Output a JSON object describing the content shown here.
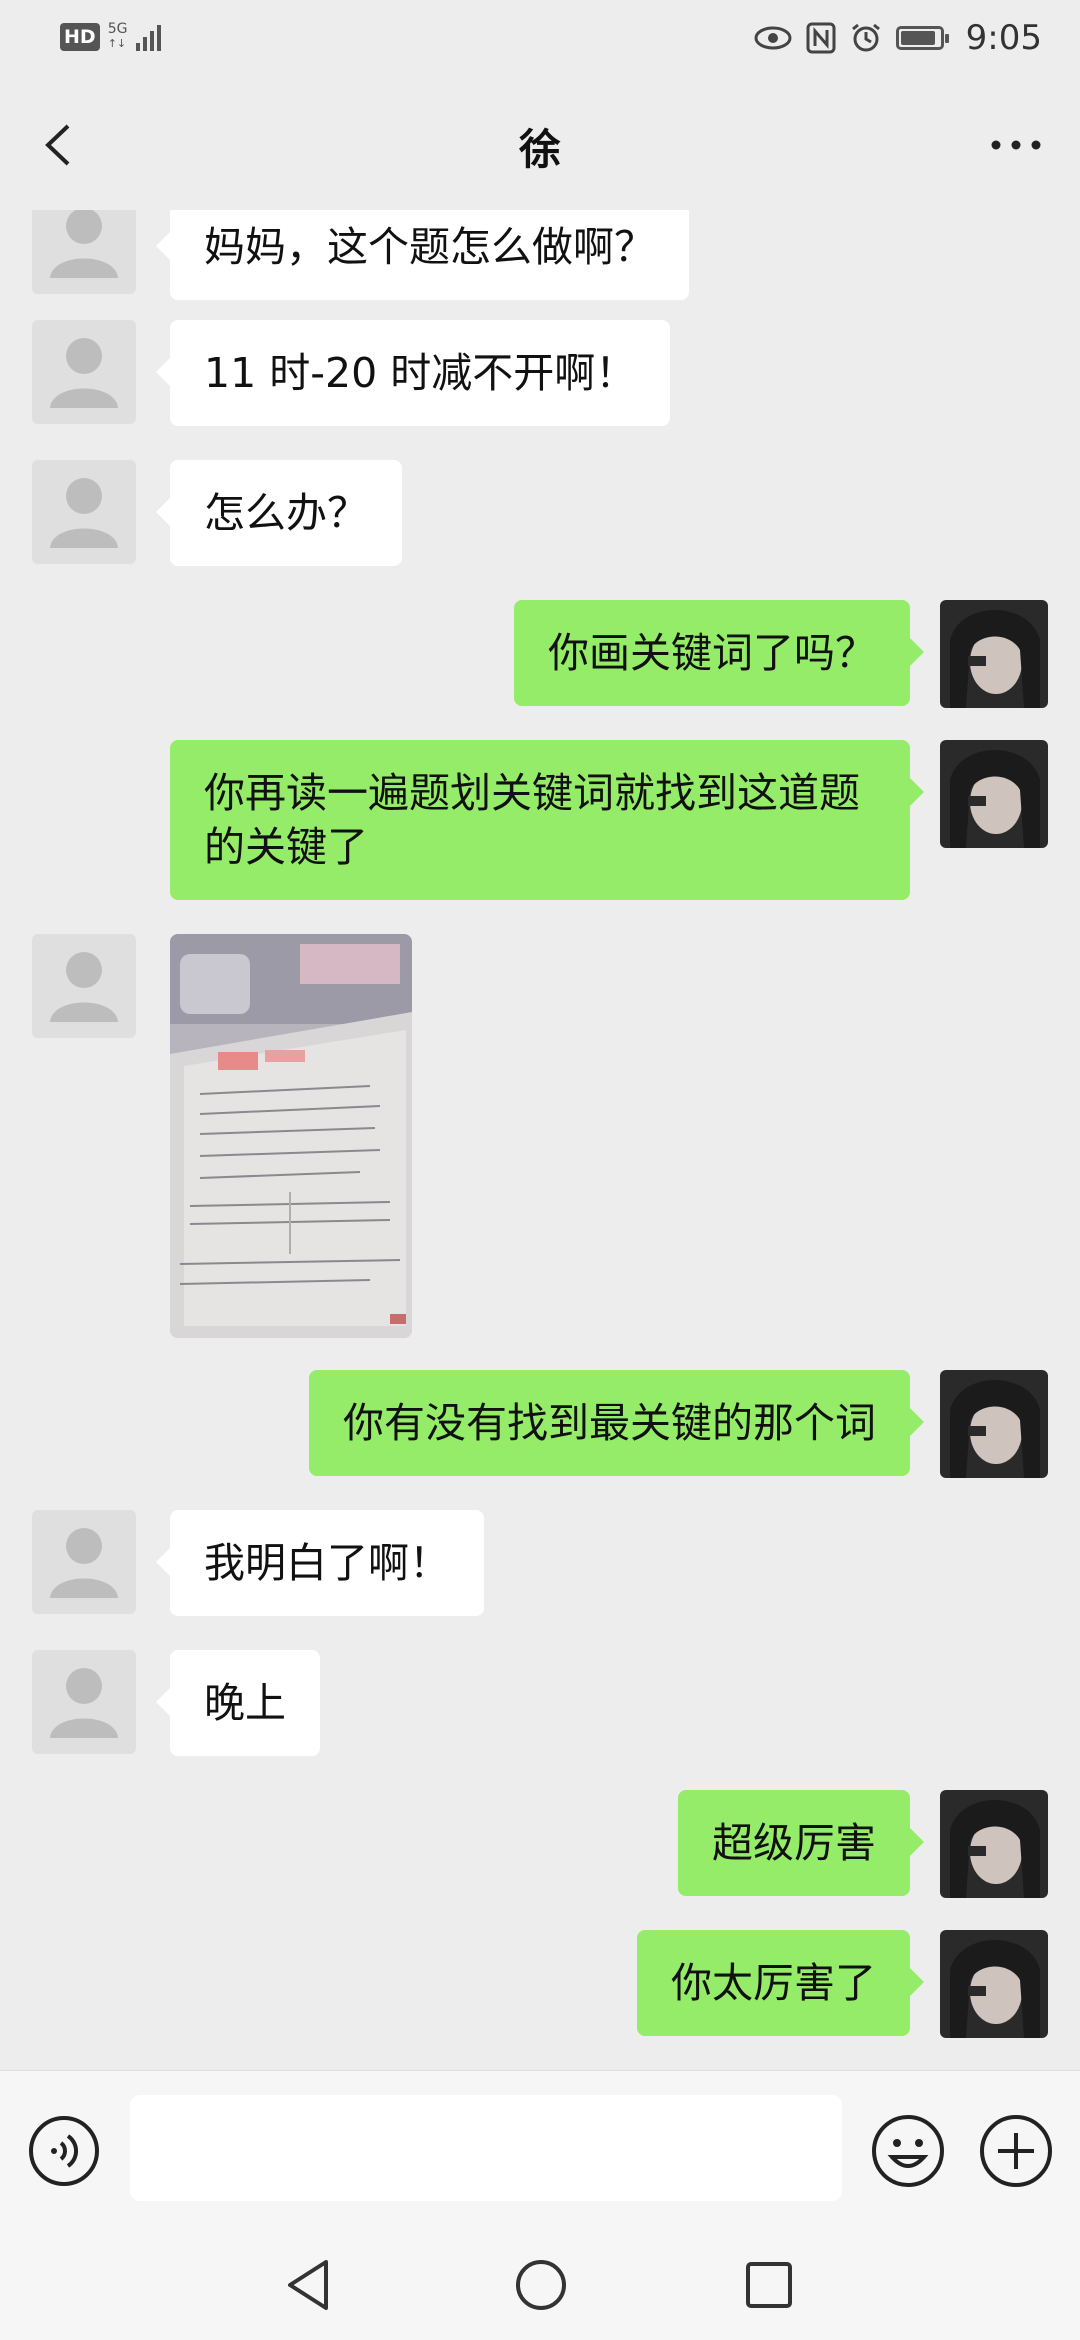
{
  "status_bar": {
    "hd_badge": "HD",
    "network": "5G",
    "network_sub": "↑↓",
    "time": "9:05",
    "icons": [
      "eye-icon",
      "nfc-icon",
      "alarm-icon",
      "battery-icon"
    ],
    "battery_level": 0.9
  },
  "header": {
    "title": "徐",
    "back_icon": "chevron-left-icon",
    "more_icon": "more-dots-icon"
  },
  "messages": [
    {
      "side": "in",
      "type": "text",
      "text": "妈妈，这个题怎么做啊？"
    },
    {
      "side": "in",
      "type": "text",
      "text": "11 时-20 时减不开啊！"
    },
    {
      "side": "in",
      "type": "text",
      "text": "怎么办？"
    },
    {
      "side": "out",
      "type": "text",
      "text": "你画关键词了吗？"
    },
    {
      "side": "out",
      "type": "text",
      "text": "你再读一遍题划关键词就找到这道题的关键了"
    },
    {
      "side": "in",
      "type": "image",
      "text": ""
    },
    {
      "side": "out",
      "type": "text",
      "text": "你有没有找到最关键的那个词"
    },
    {
      "side": "in",
      "type": "text",
      "text": "我明白了啊！"
    },
    {
      "side": "in",
      "type": "text",
      "text": "晚上"
    },
    {
      "side": "out",
      "type": "text",
      "text": "超级厉害"
    },
    {
      "side": "out",
      "type": "text",
      "text": "你太厉害了"
    }
  ],
  "input_bar": {
    "voice_icon": "voice-icon",
    "input_value": "",
    "emoji_icon": "emoji-icon",
    "plus_icon": "plus-circle-icon"
  },
  "nav_bar": {
    "icons": [
      "nav-back-icon",
      "nav-home-icon",
      "nav-recent-icon"
    ]
  },
  "colors": {
    "background": "#ededed",
    "incoming_bubble": "#ffffff",
    "outgoing_bubble": "#95ec69"
  }
}
